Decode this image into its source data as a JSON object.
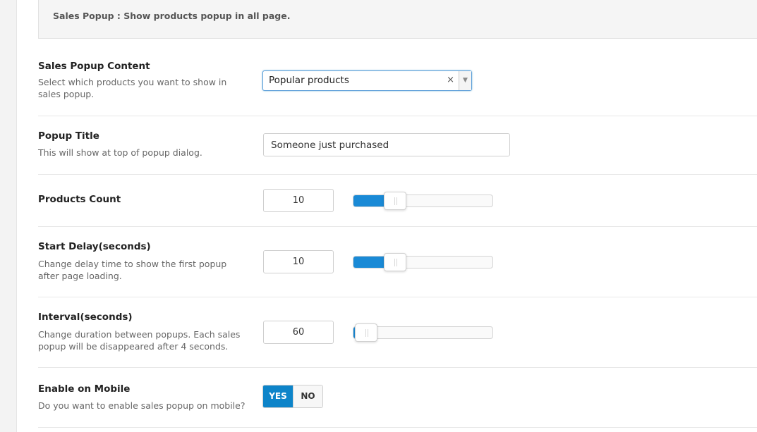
{
  "notice": {
    "text": "Sales Popup : Show products popup in all page."
  },
  "fields": {
    "content": {
      "title": "Sales Popup Content",
      "description": "Select which products you want to show in sales popup.",
      "selected": "Popular products",
      "clear_icon": "×",
      "arrow_icon": "▼"
    },
    "popup_title": {
      "title": "Popup Title",
      "description": "This will show at top of popup dialog.",
      "value": "Someone just purchased"
    },
    "products_count": {
      "title": "Products Count",
      "value": "10",
      "slider_fraction": 0.26
    },
    "start_delay": {
      "title": "Start Delay(seconds)",
      "description": "Change delay time to show the first popup after page loading.",
      "value": "10",
      "slider_fraction": 0.26
    },
    "interval": {
      "title": "Interval(seconds)",
      "description": "Change duration between popups. Each sales popup will be disappeared after 4 seconds.",
      "value": "60",
      "slider_fraction": 0.01
    },
    "enable_mobile": {
      "title": "Enable on Mobile",
      "description": "Do you want to enable sales popup on mobile?",
      "yes_label": "YES",
      "no_label": "NO",
      "selected": "YES"
    }
  },
  "colors": {
    "accent": "#0d84c9",
    "slider_fill": "#1a8ad6"
  }
}
